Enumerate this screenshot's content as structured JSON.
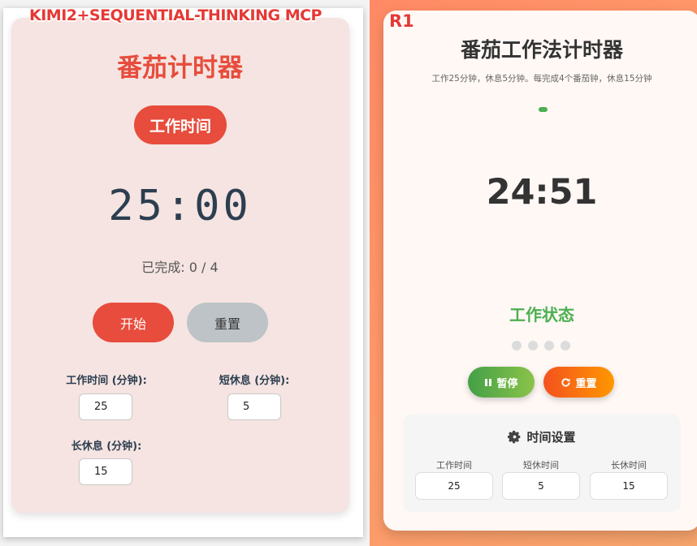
{
  "left": {
    "tag": "KIMI2+SEQUENTIAL-THINKING MCP",
    "title": "番茄计时器",
    "mode": "工作时间",
    "time": "25:00",
    "progress": "已完成: 0 / 4",
    "start_label": "开始",
    "reset_label": "重置",
    "settings": {
      "work_label": "工作时间 (分钟):",
      "work_value": "25",
      "short_label": "短休息 (分钟):",
      "short_value": "5",
      "long_label": "长休息 (分钟):",
      "long_value": "15"
    }
  },
  "right": {
    "tag": "R1",
    "title": "番茄工作法计时器",
    "subtitle": "工作25分钟，休息5分钟。每完成4个番茄钟，休息15分钟",
    "progress_fraction": 0.03,
    "time": "24:51",
    "status": "工作状态",
    "completed_dots": 0,
    "total_dots": 4,
    "pause_label": "暂停",
    "reset_label": "重置",
    "settings_title": "时间设置",
    "settings": {
      "work_label": "工作时间",
      "work_value": "25",
      "short_label": "短休时间",
      "short_value": "5",
      "long_label": "长休时间",
      "long_value": "15"
    },
    "icons": {
      "pause": "pause-icon",
      "reset": "redo-icon",
      "settings": "gear-icon"
    }
  },
  "colors": {
    "left_accent": "#e74c3c",
    "left_card_bg": "#f5e4e1",
    "right_green": "#4caf50",
    "right_orange": "#ff9800",
    "right_bg": "#ff8a65"
  }
}
